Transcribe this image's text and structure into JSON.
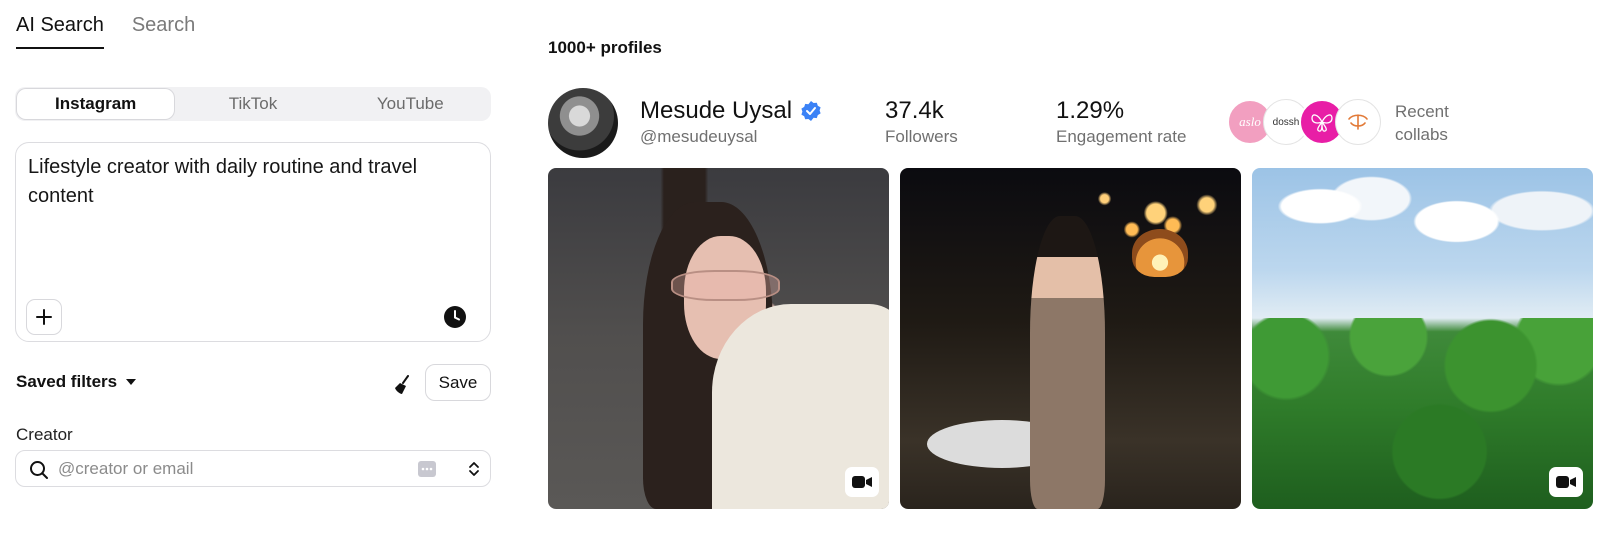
{
  "search_tabs": [
    {
      "label": "AI Search",
      "active": true
    },
    {
      "label": "Search",
      "active": false
    }
  ],
  "platforms": [
    {
      "label": "Instagram",
      "active": true
    },
    {
      "label": "TikTok",
      "active": false
    },
    {
      "label": "YouTube",
      "active": false
    }
  ],
  "query": {
    "text": "Lifestyle creator with daily routine and travel content"
  },
  "filters": {
    "saved_filters_label": "Saved filters",
    "save_label": "Save",
    "creator_label": "Creator",
    "creator_placeholder": "@creator or email"
  },
  "results": {
    "count_label": "1000+ profiles",
    "profile": {
      "name": "Mesude Uysal",
      "handle": "@mesudeuysal",
      "verified": true,
      "followers_value": "37.4k",
      "followers_label": "Followers",
      "engagement_value": "1.29%",
      "engagement_label": "Engagement rate",
      "collabs": [
        {
          "text": "aslo",
          "bg": "#f29fc0",
          "color": "#ffffff"
        },
        {
          "text": "dossh",
          "bg": "#ffffff",
          "color": "#333333"
        },
        {
          "text": "",
          "bg": "#e81ea6",
          "color": "#ffffff"
        },
        {
          "text": "",
          "bg": "#ffffff",
          "color": "#e27a38"
        }
      ],
      "recent_collabs_label": "Recent collabs",
      "posts": [
        {
          "type": "video"
        },
        {
          "type": "image"
        },
        {
          "type": "video"
        }
      ]
    }
  },
  "colors": {
    "accent_verified": "#3b82f6",
    "muted_text": "#707070"
  }
}
